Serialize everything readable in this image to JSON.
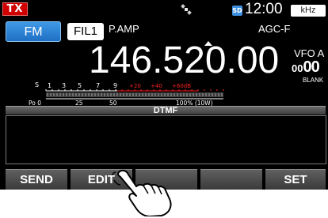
{
  "status_bar": {
    "tx_label": "TX",
    "satellite_icon": "satellite-icon",
    "sd_card_label": "SD",
    "time": "12:00",
    "step_unit": "kHz"
  },
  "mode_row": {
    "mode": "FM",
    "filter": "FIL1",
    "preamp": "P.AMP",
    "agc": "AGC-F"
  },
  "frequency": {
    "value": "146.520.00",
    "vfo_label": "VFO A",
    "memory_display": "00",
    "memory_prefix": "00",
    "memory_name": "BLANK"
  },
  "meter": {
    "s_scale": [
      "S",
      "1",
      "3",
      "5",
      "7",
      "9"
    ],
    "s_plus_scale": [
      "+20",
      "+40",
      "+60dB"
    ],
    "po_scale": [
      "Po 0",
      "25",
      "50",
      "100% (10W)"
    ]
  },
  "dtmf": {
    "title": "DTMF"
  },
  "function_keys": [
    {
      "label": "SEND"
    },
    {
      "label": "EDIT"
    },
    {
      "label": ""
    },
    {
      "label": ""
    },
    {
      "label": "SET"
    }
  ],
  "colors": {
    "tx_red": "#d00000",
    "fm_blue": "#2f86da",
    "meter_red": "#ff2020",
    "background": "#000000"
  }
}
